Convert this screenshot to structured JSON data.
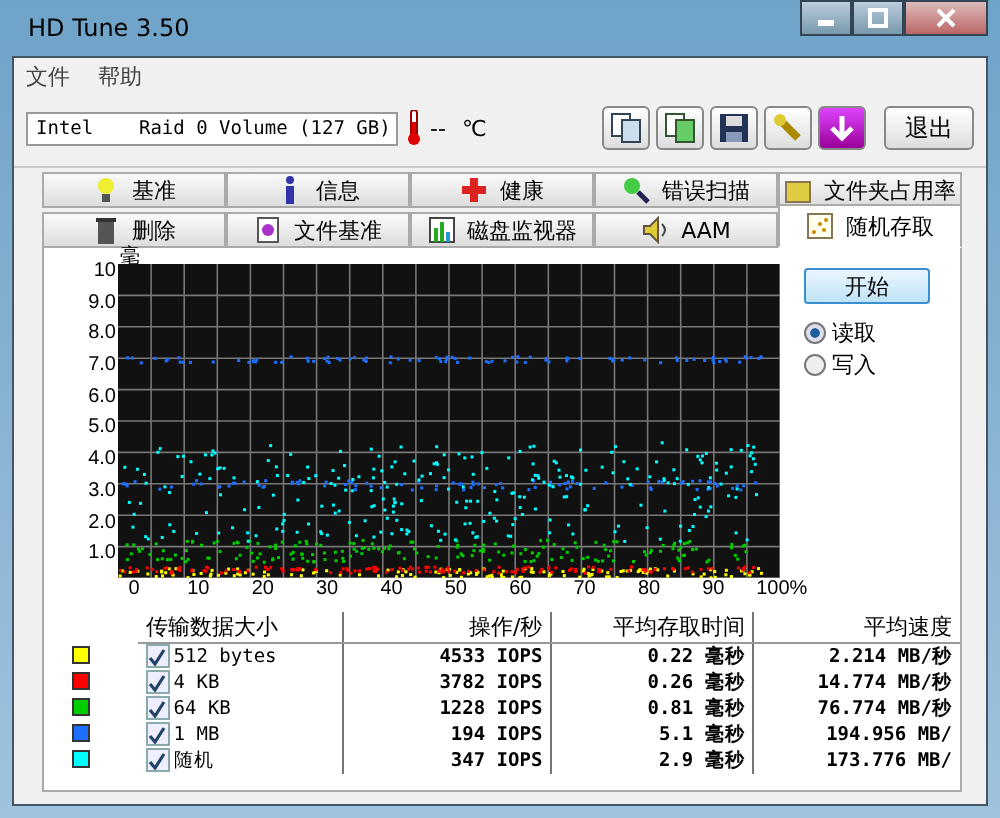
{
  "window": {
    "title": "HD Tune 3.50"
  },
  "menu": [
    "文件",
    "帮助"
  ],
  "toolbar": {
    "drive": "Intel    Raid 0 Volume (127 GB)",
    "temperature": "--",
    "temp_unit": "℃",
    "exit": "退出"
  },
  "tabs_row1": [
    {
      "label": "基准",
      "selected": false
    },
    {
      "label": "信息",
      "selected": false
    },
    {
      "label": "健康",
      "selected": false
    },
    {
      "label": "错误扫描",
      "selected": false
    },
    {
      "label": "文件夹占用率",
      "selected": false
    }
  ],
  "tabs_row2": [
    {
      "label": "删除",
      "selected": false
    },
    {
      "label": "文件基准",
      "selected": false
    },
    {
      "label": "磁盘监视器",
      "selected": false
    },
    {
      "label": "AAM",
      "selected": false
    },
    {
      "label": "随机存取",
      "selected": true
    }
  ],
  "chart": {
    "y_unit": "毫",
    "y_labels": [
      "10",
      "9.0",
      "8.0",
      "7.0",
      "6.0",
      "5.0",
      "4.0",
      "3.0",
      "2.0",
      "1.0"
    ],
    "x_labels": [
      "0",
      "10",
      "20",
      "30",
      "40",
      "50",
      "60",
      "70",
      "80",
      "90",
      "100%"
    ]
  },
  "start_button": "开始",
  "modes": [
    {
      "label": "读取",
      "selected": true
    },
    {
      "label": "写入",
      "selected": false
    }
  ],
  "table": {
    "columns": [
      "传输数据大小",
      "操作/秒",
      "平均存取时间",
      "平均速度"
    ],
    "rows": [
      {
        "color": "#ffff00",
        "checked": true,
        "size": "512 bytes",
        "ops": "4533 IOPS",
        "time": "0.22",
        "time_unit": "毫秒",
        "speed": "2.214 MB/秒"
      },
      {
        "color": "#ff0000",
        "checked": true,
        "size": "4 KB",
        "ops": "3782 IOPS",
        "time": "0.26",
        "time_unit": "毫秒",
        "speed": "14.774 MB/秒"
      },
      {
        "color": "#00cc00",
        "checked": true,
        "size": "64 KB",
        "ops": "1228 IOPS",
        "time": "0.81",
        "time_unit": "毫秒",
        "speed": "76.774 MB/秒"
      },
      {
        "color": "#1e6fff",
        "checked": true,
        "size": "1 MB",
        "ops": "194 IOPS",
        "time": "5.1",
        "time_unit": "毫秒",
        "speed": "194.956 MB/"
      },
      {
        "color": "#00ffff",
        "checked": true,
        "size": "随机",
        "ops": "347 IOPS",
        "time": "2.9",
        "time_unit": "毫秒",
        "speed": "173.776 MB/"
      }
    ]
  }
}
